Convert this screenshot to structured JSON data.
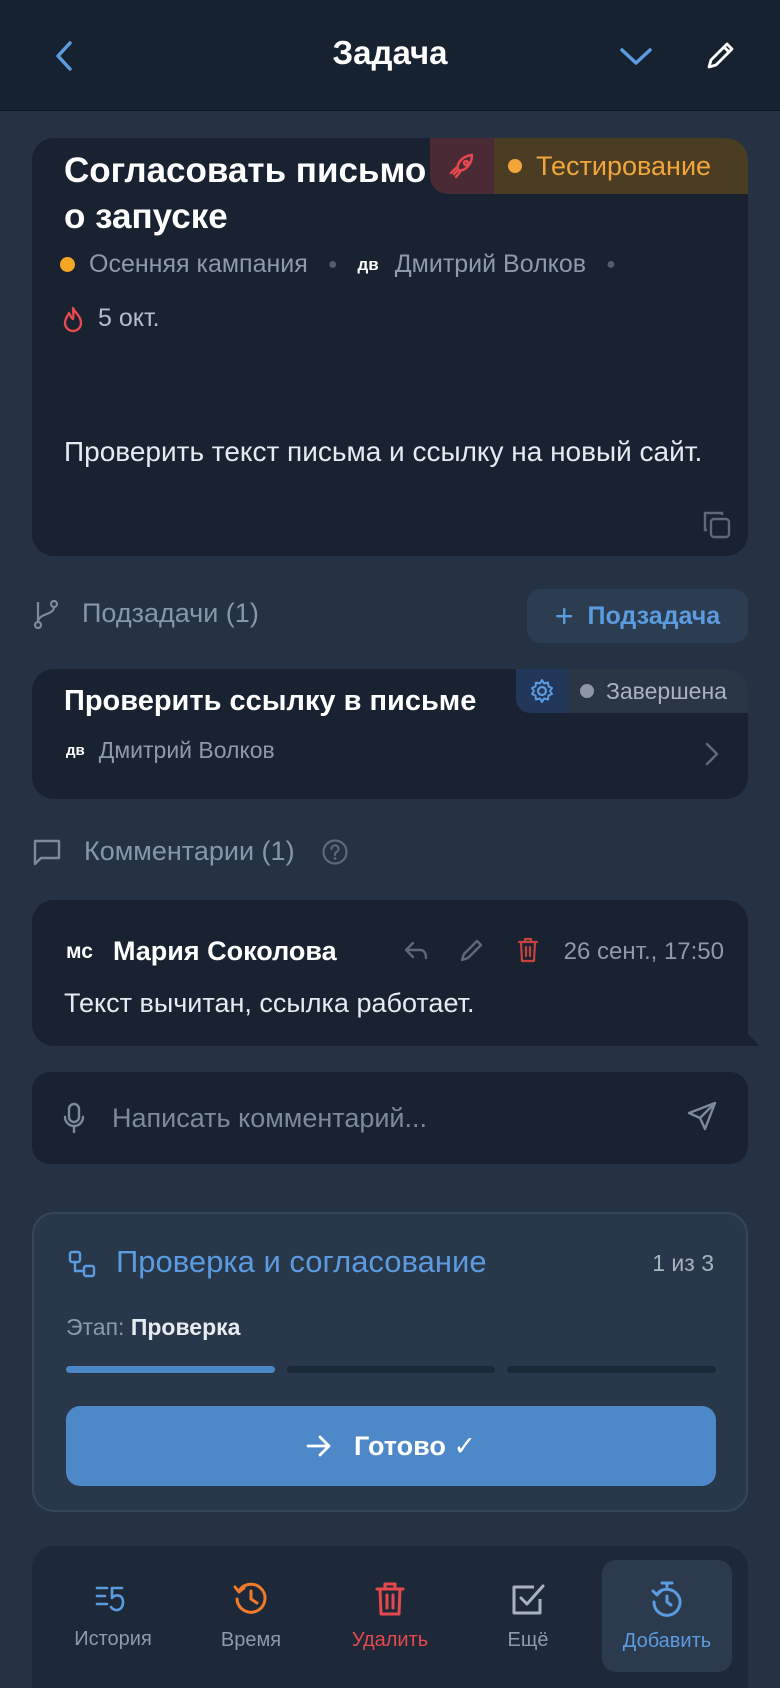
{
  "header": {
    "title": "Задача"
  },
  "task": {
    "title": "Согласовать письмо о запуске",
    "status": "Тестирование",
    "project": "Осенняя кампания",
    "assignee_initials": "дв",
    "assignee": "Дмитрий Волков",
    "due": "5 окт.",
    "description": "Проверить текст письма и ссылку на новый сайт."
  },
  "subtasks": {
    "heading": "Подзадачи (1)",
    "add_label": "Подзадача",
    "items": [
      {
        "title": "Проверить ссылку в письме",
        "assignee_initials": "дв",
        "assignee": "Дмитрий Волков",
        "status": "Завершена"
      }
    ]
  },
  "comments": {
    "heading": "Комментарии (1)",
    "items": [
      {
        "author_initials": "мс",
        "author": "Мария Соколова",
        "time": "26 сент., 17:50",
        "text": "Текст вычитан, ссылка работает."
      }
    ],
    "input_placeholder": "Написать комментарий..."
  },
  "workflow": {
    "title": "Проверка и согласование",
    "count": "1 из 3",
    "stage_label": "Этап:",
    "stage_value": "Проверка",
    "progress": 0.333,
    "done_label": "Готово ✓"
  },
  "tabs": [
    {
      "label": "История",
      "icon": "history-icon"
    },
    {
      "label": "Время",
      "icon": "clock-icon"
    },
    {
      "label": "Удалить",
      "icon": "trash-icon"
    },
    {
      "label": "Ещё",
      "icon": "checkbox-icon"
    },
    {
      "label": "Добавить",
      "icon": "timer-icon"
    }
  ],
  "colors": {
    "accent": "#5b9be0",
    "status_testing": "#f3a53a",
    "danger": "#e5484d",
    "time": "#f07a2a",
    "project_dot": "#f5a623"
  }
}
